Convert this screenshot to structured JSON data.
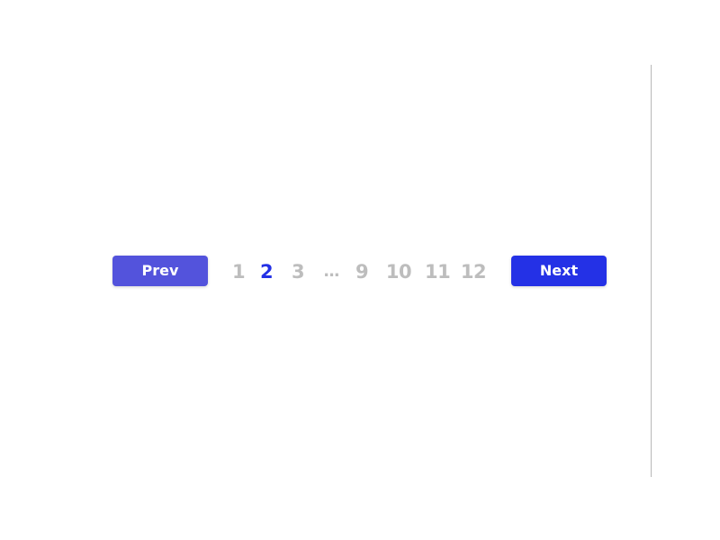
{
  "pagination": {
    "prev_label": "Prev",
    "next_label": "Next",
    "current_page": 2,
    "pages": [
      {
        "label": "1",
        "active": false
      },
      {
        "label": "2",
        "active": true
      },
      {
        "label": "3",
        "active": false
      },
      {
        "label": "...",
        "active": false,
        "ellipsis": true
      },
      {
        "label": "9",
        "active": false
      },
      {
        "label": "10",
        "active": false
      },
      {
        "label": "11",
        "active": false
      },
      {
        "label": "12",
        "active": false
      }
    ]
  },
  "colors": {
    "prev_button": "#5353dc",
    "next_button": "#2431e6",
    "active_page": "#2431e6",
    "inactive_page": "#bdbdbd",
    "divider": "#b8b8b8"
  }
}
